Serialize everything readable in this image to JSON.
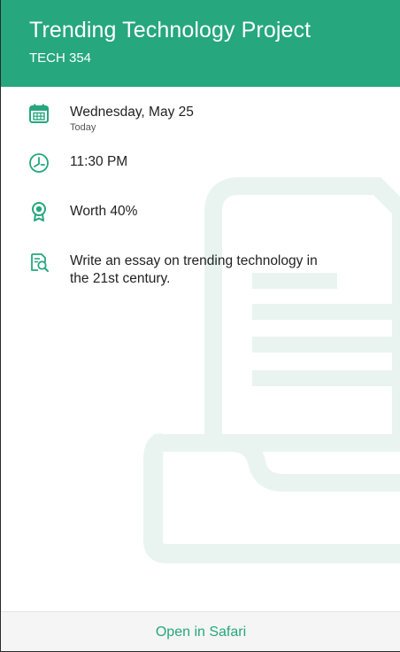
{
  "header": {
    "title": "Trending Technology Project",
    "subtitle": "TECH 354"
  },
  "details": {
    "date": "Wednesday, May 25",
    "date_relative": "Today",
    "time": "11:30 PM",
    "worth": "Worth 40%",
    "description_line1": "Write an essay on trending technology in",
    "description_line2": "the 21st century."
  },
  "footer": {
    "open_button_label": "Open in Safari"
  },
  "colors": {
    "accent": "#26a77d",
    "watermark": "#e9f4f0",
    "footer_bg": "#f5f5f5"
  },
  "icons": {
    "date": "calendar-icon",
    "time": "clock-icon",
    "worth": "award-ribbon-icon",
    "description": "document-magnifier-icon"
  }
}
